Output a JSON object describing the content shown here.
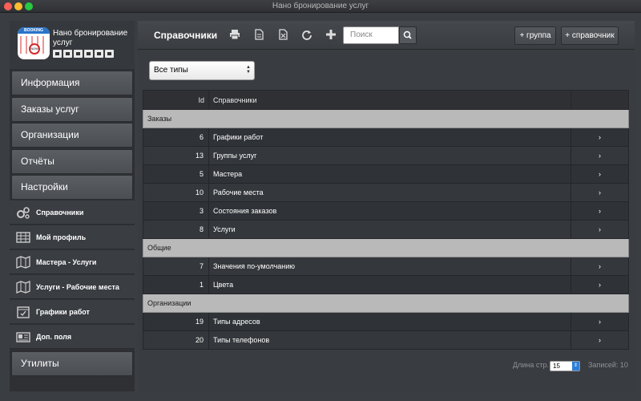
{
  "window": {
    "title": "Нано бронирование услуг"
  },
  "sidebar": {
    "app_name": "Нано бронирование услуг",
    "logo_text": "BOOKING",
    "logo_badge": "NOW",
    "nav": [
      {
        "label": "Информация"
      },
      {
        "label": "Заказы услуг"
      },
      {
        "label": "Организации"
      },
      {
        "label": "Отчёты"
      },
      {
        "label": "Настройки"
      }
    ],
    "sub_items": [
      {
        "label": "Справочники",
        "icon": "gears-icon"
      },
      {
        "label": "Мой профиль",
        "icon": "table-icon"
      },
      {
        "label": "Мастера - Услуги",
        "icon": "map-icon"
      },
      {
        "label": "Услуги - Рабочие места",
        "icon": "map-icon"
      },
      {
        "label": "Графики работ",
        "icon": "calendar-check-icon"
      },
      {
        "label": "Доп. поля",
        "icon": "newspaper-icon"
      }
    ],
    "utilities": "Утилиты"
  },
  "toolbar": {
    "title": "Справочники",
    "search_placeholder": "Поиск",
    "add_group": "+ группа",
    "add_reference": "+ справочник",
    "icons": [
      "print-icon",
      "document-icon",
      "excel-icon",
      "refresh-icon",
      "plus-icon"
    ]
  },
  "filter": {
    "selected": "Все типы"
  },
  "table": {
    "columns": [
      "Id",
      "Справочники",
      ""
    ],
    "groups": [
      {
        "name": "Заказы",
        "rows": [
          {
            "id": "6",
            "name": "Графики работ"
          },
          {
            "id": "13",
            "name": "Группы услуг"
          },
          {
            "id": "5",
            "name": "Мастера"
          },
          {
            "id": "10",
            "name": "Рабочие места"
          },
          {
            "id": "3",
            "name": "Состояния заказов"
          },
          {
            "id": "8",
            "name": "Услуги"
          }
        ]
      },
      {
        "name": "Общие",
        "rows": [
          {
            "id": "7",
            "name": "Значения по-умолчанию"
          },
          {
            "id": "1",
            "name": "Цвета"
          }
        ]
      },
      {
        "name": "Организации",
        "rows": [
          {
            "id": "19",
            "name": "Типы адресов"
          },
          {
            "id": "20",
            "name": "Типы телефонов"
          }
        ]
      }
    ]
  },
  "footer": {
    "page_length_label": "Длина стр.",
    "page_length": "15",
    "records_label": "Записей: 10"
  }
}
